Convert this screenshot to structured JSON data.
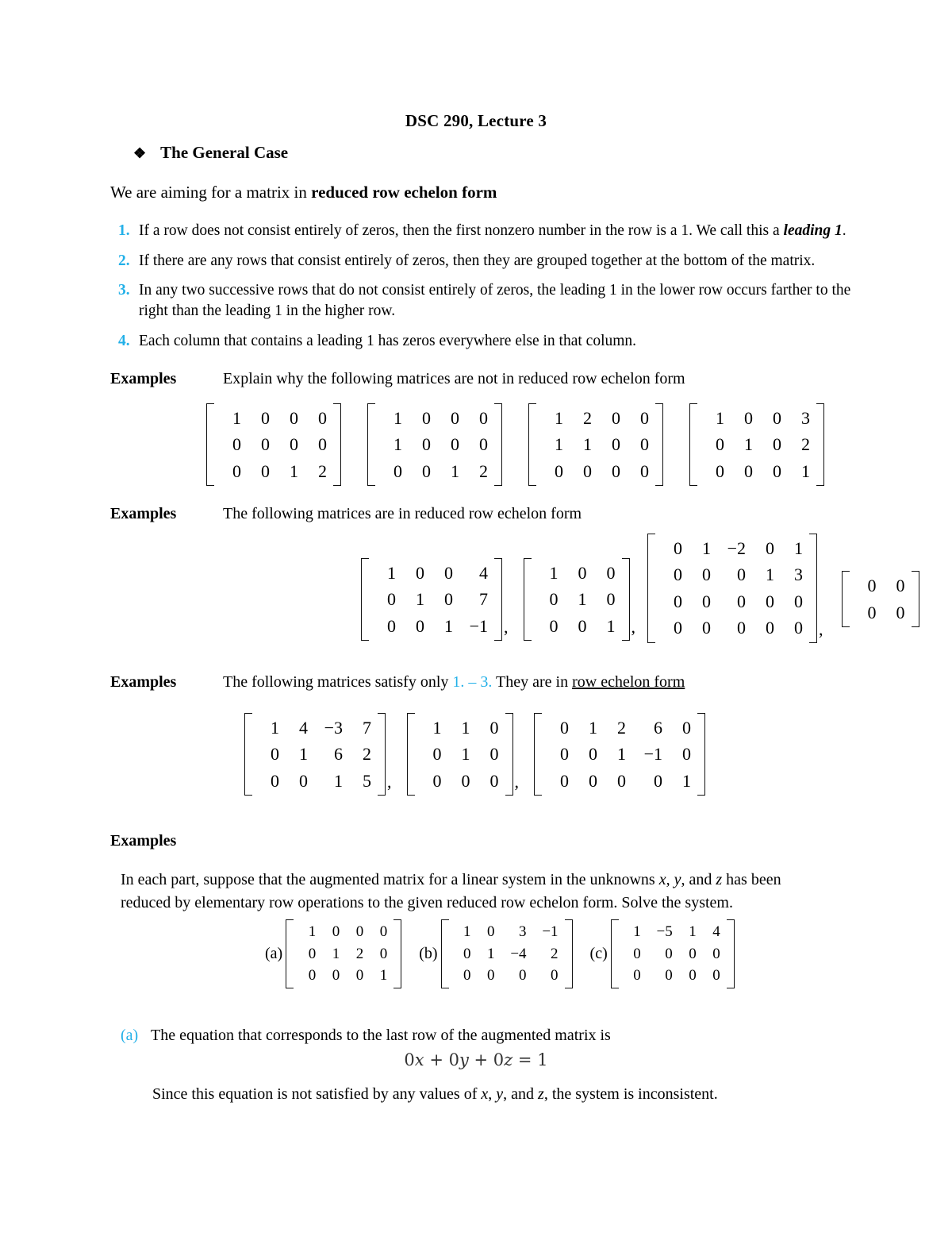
{
  "document": {
    "title": "DSC 290, Lecture 3",
    "bullet_icon": "diamond-bullet",
    "bullet_glyph": "❖",
    "section_heading": "The General Case",
    "intro_prefix": "We are aiming for a matrix in ",
    "intro_strong": "reduced row echelon form",
    "accent_color": "#23b0e8"
  },
  "rules": [
    {
      "num": "1.",
      "text_before": "If a row does not consist entirely of zeros, then the first nonzero number in the row is a 1. We call this a ",
      "emph": "leading 1",
      "text_after": "."
    },
    {
      "num": "2.",
      "text_before": "If there are any rows that consist entirely of zeros, then they are grouped together at the bottom of the matrix.",
      "emph": "",
      "text_after": ""
    },
    {
      "num": "3.",
      "text_before": "In any two successive rows that do not consist entirely of zeros, the leading 1 in the lower row occurs farther to the right than the leading 1 in the higher row.",
      "emph": "",
      "text_after": ""
    },
    {
      "num": "4.",
      "text_before": "Each column that contains a leading 1 has zeros everywhere else in that column.",
      "emph": "",
      "text_after": ""
    }
  ],
  "examples": [
    {
      "label": "Examples",
      "caption": "Explain why the following matrices are not in reduced row echelon form",
      "matrices": [
        {
          "rows": [
            [
              "1",
              "0",
              "0",
              "0"
            ],
            [
              "0",
              "0",
              "0",
              "0"
            ],
            [
              "0",
              "0",
              "1",
              "2"
            ]
          ]
        },
        {
          "rows": [
            [
              "1",
              "0",
              "0",
              "0"
            ],
            [
              "1",
              "0",
              "0",
              "0"
            ],
            [
              "0",
              "0",
              "1",
              "2"
            ]
          ]
        },
        {
          "rows": [
            [
              "1",
              "2",
              "0",
              "0"
            ],
            [
              "1",
              "1",
              "0",
              "0"
            ],
            [
              "0",
              "0",
              "0",
              "0"
            ]
          ]
        },
        {
          "rows": [
            [
              "1",
              "0",
              "0",
              "3"
            ],
            [
              "0",
              "1",
              "0",
              "2"
            ],
            [
              "0",
              "0",
              "0",
              "1"
            ]
          ]
        }
      ]
    },
    {
      "label": "Examples",
      "caption": "The following matrices are in reduced row echelon form",
      "matrices": [
        {
          "rows": [
            [
              "1",
              "0",
              "0",
              "4"
            ],
            [
              "0",
              "1",
              "0",
              "7"
            ],
            [
              "0",
              "0",
              "1",
              "−1"
            ]
          ],
          "sep": ","
        },
        {
          "rows": [
            [
              "1",
              "0",
              "0"
            ],
            [
              "0",
              "1",
              "0"
            ],
            [
              "0",
              "0",
              "1"
            ]
          ],
          "sep": ","
        },
        {
          "rows": [
            [
              "0",
              "1",
              "−2",
              "0",
              "1"
            ],
            [
              "0",
              "0",
              "0",
              "1",
              "3"
            ],
            [
              "0",
              "0",
              "0",
              "0",
              "0"
            ],
            [
              "0",
              "0",
              "0",
              "0",
              "0"
            ]
          ],
          "sep": ","
        },
        {
          "rows": [
            [
              "0",
              "0"
            ],
            [
              "0",
              "0"
            ]
          ],
          "sep": ""
        }
      ]
    },
    {
      "label": "Examples",
      "caption_before": "The following matrices satisfy only ",
      "caption_accent": "1. – 3.",
      "caption_mid": "  They are in ",
      "caption_underline": "row echelon form",
      "matrices": [
        {
          "rows": [
            [
              "1",
              "4",
              "−3",
              "7"
            ],
            [
              "0",
              "1",
              "6",
              "2"
            ],
            [
              "0",
              "0",
              "1",
              "5"
            ]
          ],
          "sep": ","
        },
        {
          "rows": [
            [
              "1",
              "1",
              "0"
            ],
            [
              "0",
              "1",
              "0"
            ],
            [
              "0",
              "0",
              "0"
            ]
          ],
          "sep": ","
        },
        {
          "rows": [
            [
              "0",
              "1",
              "2",
              "6",
              "0"
            ],
            [
              "0",
              "0",
              "1",
              "−1",
              "0"
            ],
            [
              "0",
              "0",
              "0",
              "0",
              "1"
            ]
          ],
          "sep": ""
        }
      ]
    }
  ],
  "final_example": {
    "label": "Examples",
    "prose_line1_a": "In each part, suppose that the augmented matrix for a linear system in the unknowns ",
    "prose_x": "x",
    "prose_sep1": ", ",
    "prose_y": "y",
    "prose_sep2": ", and ",
    "prose_z": "z",
    "prose_line1_b": " has been",
    "prose_line2": "reduced by elementary row operations to the given reduced row echelon form. Solve the system.",
    "matrices": [
      {
        "part": "(a)",
        "rows": [
          [
            "1",
            "0",
            "0",
            "0"
          ],
          [
            "0",
            "1",
            "2",
            "0"
          ],
          [
            "0",
            "0",
            "0",
            "1"
          ]
        ]
      },
      {
        "part": "(b)",
        "rows": [
          [
            "1",
            "0",
            "3",
            "−1"
          ],
          [
            "0",
            "1",
            "−4",
            "2"
          ],
          [
            "0",
            "0",
            "0",
            "0"
          ]
        ]
      },
      {
        "part": "(c)",
        "rows": [
          [
            "1",
            "−5",
            "1",
            "4"
          ],
          [
            "0",
            "0",
            "0",
            "0"
          ],
          [
            "0",
            "0",
            "0",
            "0"
          ]
        ]
      }
    ]
  },
  "answer": {
    "part": "(a)",
    "text": "The equation that corresponds to the last row of the augmented matrix is",
    "equation_parts": {
      "t1": "0",
      "v1": "x",
      "op1": " + ",
      "t2": "0",
      "v2": "y",
      "op2": " + ",
      "t3": "0",
      "v3": "z",
      "eq": " = ",
      "rhs": "1"
    },
    "equation_plain": "0x + 0y + 0z = 1",
    "conclusion_a": "Since this equation is not satisfied by any values of ",
    "conclusion_x": "x",
    "conclusion_s1": ", ",
    "conclusion_y": "y",
    "conclusion_s2": ", and ",
    "conclusion_z": "z",
    "conclusion_b": ", the system is inconsistent."
  }
}
